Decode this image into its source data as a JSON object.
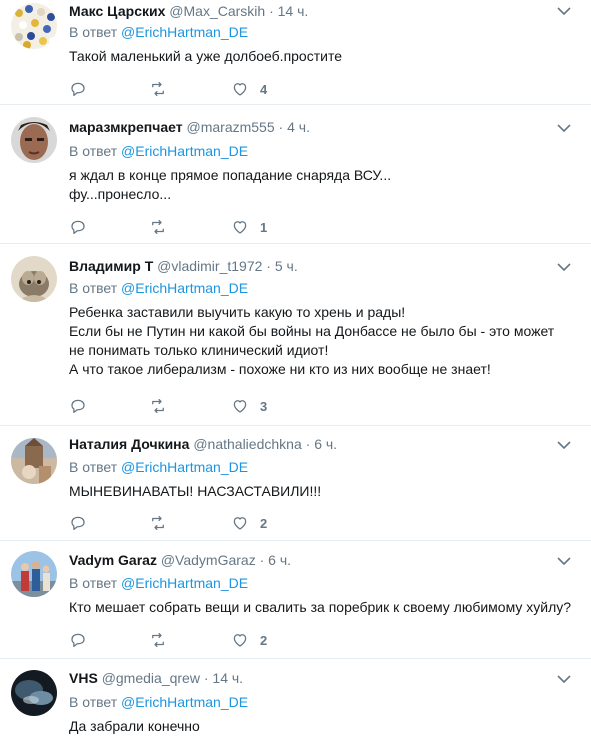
{
  "reply_prefix": "В ответ",
  "tweets": [
    {
      "name": "Макс Царских",
      "handle": "@Max_Carskih",
      "time": "14 ч.",
      "reply_to": "@ErichHartman_DE",
      "lines": [
        "Такой маленький а уже долбоеб.простите"
      ],
      "likes": "4",
      "avatar": "avatar-dots"
    },
    {
      "name": "маразмкрепчает",
      "handle": "@marazm555",
      "time": "4 ч.",
      "reply_to": "@ErichHartman_DE",
      "lines": [
        "я ждал в конце  прямое попадание снаряда ВСУ...",
        "фу...пронесло..."
      ],
      "likes": "1",
      "avatar": "avatar-face"
    },
    {
      "name": "Владимир Т",
      "handle": "@vladimir_t1972",
      "time": "5 ч.",
      "reply_to": "@ErichHartman_DE",
      "lines": [
        "Ребенка заставили выучить какую то хрень и рады!",
        "Если бы не Путин ни какой бы войны на Донбассе не было бы - это может",
        "не понимать только клинический идиот!",
        "А что такое либерализм - похоже ни кто из них вообще не знает!"
      ],
      "likes": "3",
      "avatar": "avatar-animal"
    },
    {
      "name": "Наталия Дочкина",
      "handle": "@nathaliedchkna",
      "time": "6 ч.",
      "reply_to": "@ErichHartman_DE",
      "lines": [
        "МЫНЕВИНАВАТЫ! НАСЗАСТАВИЛИ!!!"
      ],
      "likes": "2",
      "avatar": "avatar-church"
    },
    {
      "name": "Vadym Garaz",
      "handle": "@VadymGaraz",
      "time": "6 ч.",
      "reply_to": "@ErichHartman_DE",
      "lines": [
        "Кто мешает собрать вещи и свалить за поребрик к своему любимому хуйлу?"
      ],
      "likes": "2",
      "avatar": "avatar-people"
    },
    {
      "name": "VHS",
      "handle": "@gmedia_qrew",
      "time": "14 ч.",
      "reply_to": "@ErichHartman_DE",
      "lines": [
        "Да забрали конечно"
      ],
      "likes": "",
      "avatar": "avatar-dark"
    }
  ],
  "colors": {
    "link": "#1b95e0",
    "muted": "#657786",
    "text": "#14171a",
    "border": "#e6ecf0"
  }
}
